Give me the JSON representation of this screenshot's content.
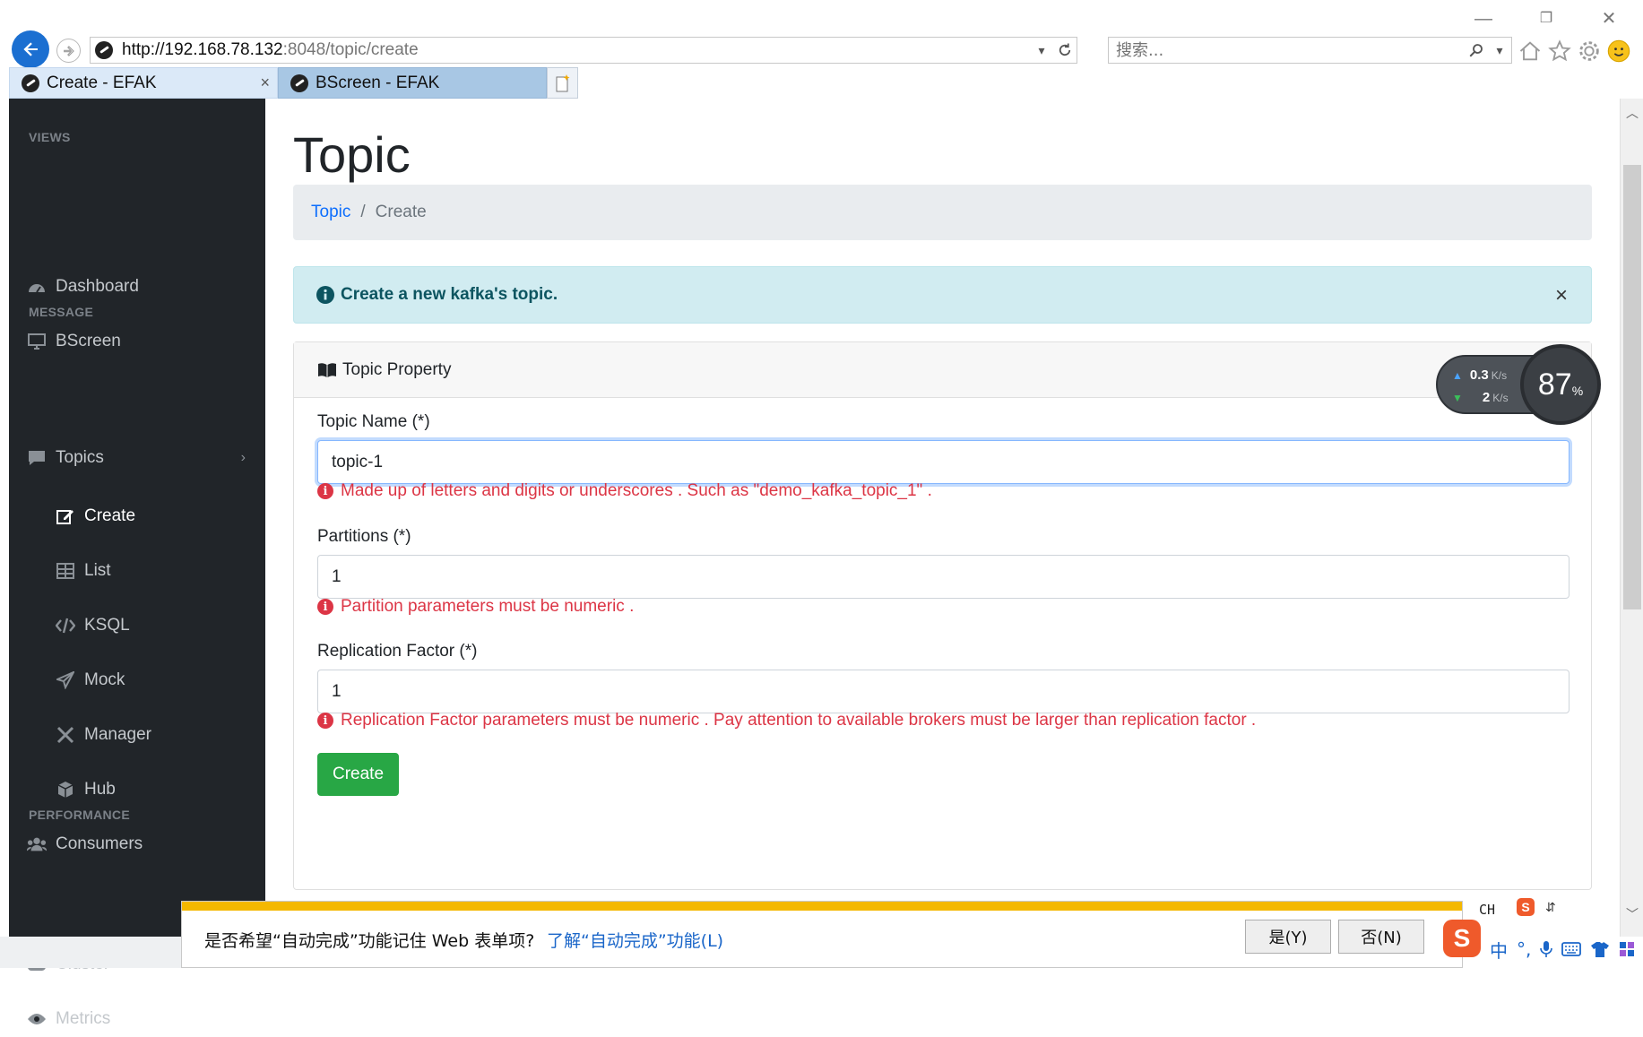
{
  "browser": {
    "url_host": "http://192.168.78.132",
    "url_rest": ":8048/topic/create",
    "search_placeholder": "搜索...",
    "tabs": [
      {
        "title": "Create - EFAK",
        "active": true
      },
      {
        "title": "BScreen - EFAK",
        "active": false
      }
    ],
    "tab_close": "×",
    "minimize": "—",
    "restore": "❐",
    "close": "✕"
  },
  "sidebar": {
    "sections": [
      {
        "heading": "VIEWS"
      },
      {
        "heading": "MESSAGE"
      },
      {
        "heading": "PERFORMANCE"
      }
    ],
    "items": {
      "dashboard": "Dashboard",
      "bscreen": "BScreen",
      "topics": "Topics",
      "create": "Create",
      "list": "List",
      "ksql": "KSQL",
      "mock": "Mock",
      "manager": "Manager",
      "hub": "Hub",
      "consumers": "Consumers",
      "cluster": "Cluster",
      "metrics": "Metrics"
    }
  },
  "page": {
    "title": "Topic",
    "breadcrumb": {
      "link": "Topic",
      "separator": "/",
      "current": "Create"
    },
    "alert": "Create a new kafka's topic.",
    "alert_close": "×",
    "card_title": "Topic Property",
    "fields": {
      "topic_name": {
        "label": "Topic Name (*)",
        "value": "topic-1",
        "error": "Made up of letters and digits or underscores . Such as \"demo_kafka_topic_1\" ."
      },
      "partitions": {
        "label": "Partitions (*)",
        "value": "1",
        "error": "Partition parameters must be numeric ."
      },
      "replication": {
        "label": "Replication Factor (*)",
        "value": "1",
        "error": "Replication Factor parameters must be numeric . Pay attention to available brokers must be larger than replication factor ."
      }
    },
    "create_button": "Create"
  },
  "speed_widget": {
    "up": "0.3",
    "down": "2",
    "unit": "K/s",
    "percent": "87",
    "percent_sign": "%"
  },
  "autocomplete_bar": {
    "text": "是否希望“自动完成”功能记住 Web 表单项?",
    "link": "了解“自动完成”功能(L)",
    "yes": "是(Y)",
    "no": "否(N)"
  },
  "ime": {
    "lang": "CH",
    "logo": "S",
    "mode": "中",
    "punct": "°,"
  },
  "colors": {
    "sidebar_bg": "#212529",
    "link": "#0d6efd",
    "error": "#dc3545",
    "success": "#28a745",
    "alert_bg": "#d1ecf1"
  }
}
